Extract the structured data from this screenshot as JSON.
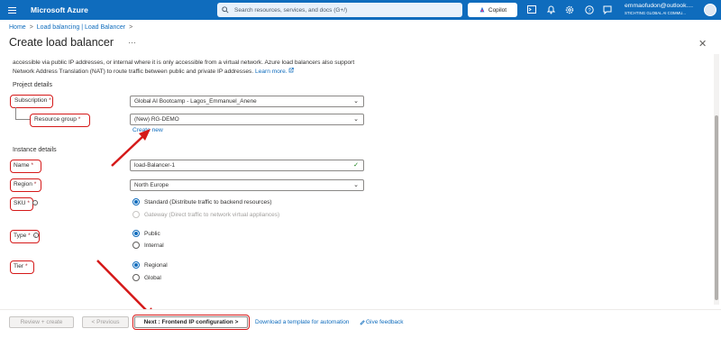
{
  "topbar": {
    "brand": "Microsoft Azure",
    "search_placeholder": "Search resources, services, and docs (G+/)",
    "copilot_label": "Copilot",
    "account_email": "emmaofudon@outlook....",
    "account_org": "STICHTING GLOBAL AI COMMU...",
    "icons": [
      "menu-icon",
      "search-icon",
      "copilot-icon",
      "cloud-shell-icon",
      "bell-icon",
      "gear-icon",
      "help-icon",
      "feedback-icon",
      "avatar"
    ],
    "color": "#0f6cbd"
  },
  "breadcrumb": {
    "home": "Home",
    "separator": ">",
    "current": "Load balancing | Load Balancer",
    "trailing": ">"
  },
  "page": {
    "title": "Create load balancer",
    "more_label": "···",
    "close_label": "✕"
  },
  "intro": {
    "text": "accessible via public IP addresses, or internal where it is only accessible from a virtual network. Azure load balancers also support Network Address Translation (NAT) to route traffic between public and private IP addresses.",
    "learn_more": "Learn more."
  },
  "project": {
    "heading": "Project details",
    "subscription_label": "Subscription",
    "subscription_value": "Global AI Bootcamp - Lagos_Emmanuel_Anene",
    "resource_group_label": "Resource group",
    "resource_group_value": "(New) RG-DEMO",
    "create_new": "Create new"
  },
  "instance": {
    "heading": "Instance details",
    "name_label": "Name",
    "name_value": "load-Balancer-1",
    "region_label": "Region",
    "region_value": "North Europe",
    "sku_label": "SKU",
    "sku_options": [
      "Standard (Distribute traffic to backend resources)",
      "Gateway (Direct traffic to network virtual appliances)"
    ],
    "sku_selected": "Standard (Distribute traffic to backend resources)",
    "type_label": "Type",
    "type_options": [
      "Public",
      "Internal"
    ],
    "type_selected": "Public",
    "tier_label": "Tier",
    "tier_options": [
      "Regional",
      "Global"
    ],
    "tier_selected": "Regional"
  },
  "required_marker": "*",
  "footer": {
    "review_create": "Review + create",
    "previous": "< Previous",
    "next": "Next : Frontend IP configuration >",
    "download_template": "Download a template for automation",
    "give_feedback": "Give feedback"
  },
  "annotation_color": "#d51919"
}
